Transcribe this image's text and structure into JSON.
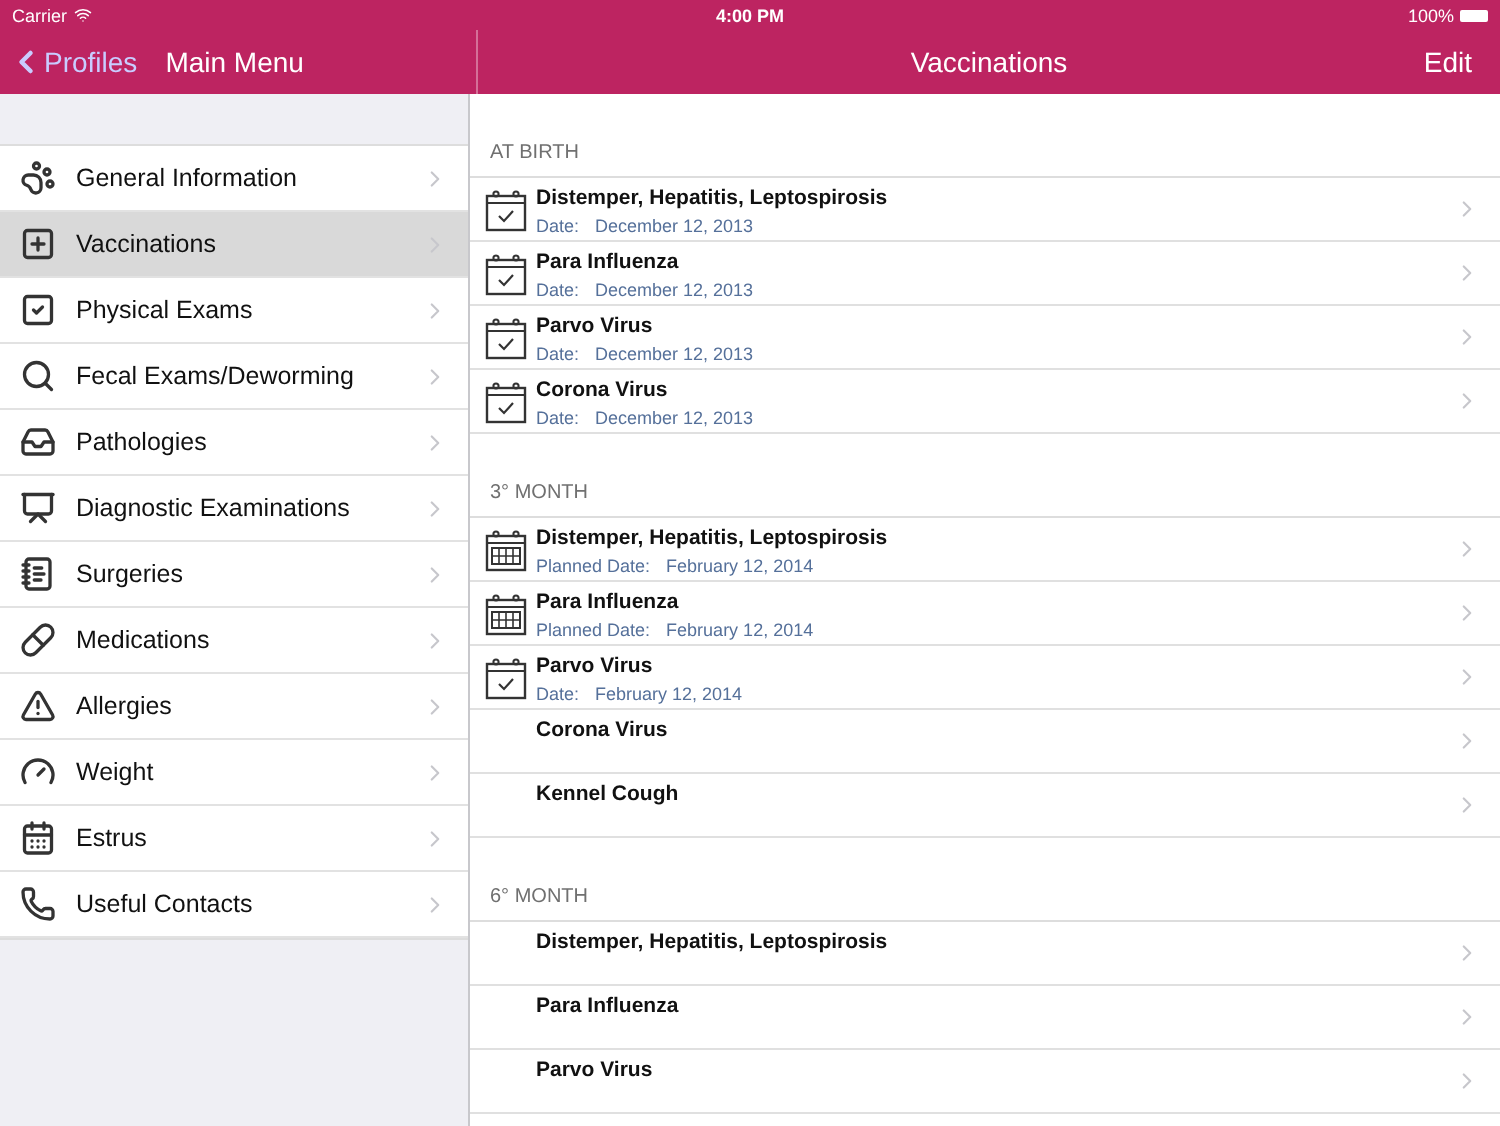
{
  "status_bar": {
    "carrier": "Carrier",
    "time": "4:00 PM",
    "battery": "100%"
  },
  "nav_left": {
    "back": "Profiles",
    "title": "Main Menu"
  },
  "nav_right": {
    "title": "Vaccinations",
    "action": "Edit"
  },
  "sidebar": {
    "items": [
      {
        "label": "General Information",
        "selected": false
      },
      {
        "label": "Vaccinations",
        "selected": true
      },
      {
        "label": "Physical Exams",
        "selected": false
      },
      {
        "label": "Fecal Exams/Deworming",
        "selected": false
      },
      {
        "label": "Pathologies",
        "selected": false
      },
      {
        "label": "Diagnostic Examinations",
        "selected": false
      },
      {
        "label": "Surgeries",
        "selected": false
      },
      {
        "label": "Medications",
        "selected": false
      },
      {
        "label": "Allergies",
        "selected": false
      },
      {
        "label": "Weight",
        "selected": false
      },
      {
        "label": "Estrus",
        "selected": false
      },
      {
        "label": "Useful Contacts",
        "selected": false
      }
    ]
  },
  "sections": [
    {
      "title": "AT BIRTH",
      "rows": [
        {
          "name": "Distemper, Hepatitis, Leptospirosis",
          "kind": "done",
          "date_label": "Date:",
          "date": "December 12, 2013"
        },
        {
          "name": "Para Influenza",
          "kind": "done",
          "date_label": "Date:",
          "date": "December 12, 2013"
        },
        {
          "name": "Parvo Virus",
          "kind": "done",
          "date_label": "Date:",
          "date": "December 12, 2013"
        },
        {
          "name": "Corona Virus",
          "kind": "done",
          "date_label": "Date:",
          "date": "December 12, 2013"
        }
      ]
    },
    {
      "title": "3° MONTH",
      "rows": [
        {
          "name": "Distemper, Hepatitis, Leptospirosis",
          "kind": "planned",
          "date_label": "Planned Date:",
          "date": "February 12, 2014"
        },
        {
          "name": "Para Influenza",
          "kind": "planned",
          "date_label": "Planned Date:",
          "date": "February 12, 2014"
        },
        {
          "name": "Parvo Virus",
          "kind": "done",
          "date_label": "Date:",
          "date": "February 12, 2014"
        },
        {
          "name": "Corona Virus",
          "kind": "none"
        },
        {
          "name": "Kennel Cough",
          "kind": "none"
        }
      ]
    },
    {
      "title": "6° MONTH",
      "rows": [
        {
          "name": "Distemper, Hepatitis, Leptospirosis",
          "kind": "none"
        },
        {
          "name": "Para Influenza",
          "kind": "none"
        },
        {
          "name": "Parvo Virus",
          "kind": "none"
        }
      ]
    }
  ]
}
